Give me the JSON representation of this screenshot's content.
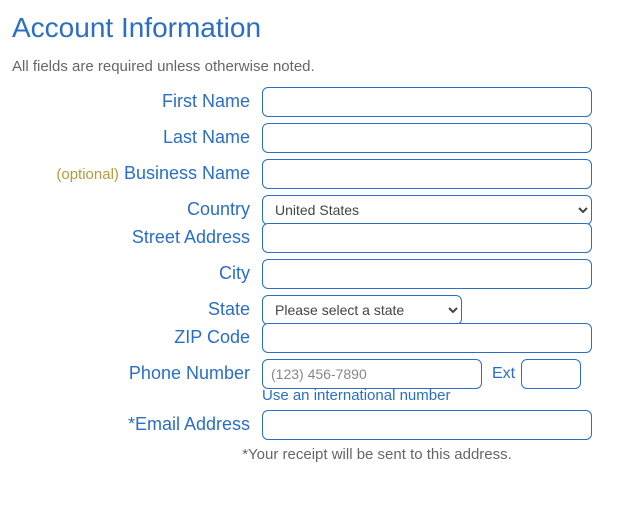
{
  "heading": "Account Information",
  "required_note": "All fields are required unless otherwise noted.",
  "labels": {
    "first_name": "First Name",
    "last_name": "Last Name",
    "optional": "(optional)",
    "business_name": "Business Name",
    "country": "Country",
    "street_address": "Street Address",
    "city": "City",
    "state": "State",
    "zip": "ZIP Code",
    "phone": "Phone Number",
    "ext": "Ext",
    "email": "*Email Address"
  },
  "values": {
    "first_name": "",
    "last_name": "",
    "business_name": "",
    "country_selected": "United States",
    "street_address": "",
    "city": "",
    "state_selected": "Please select a state",
    "zip": "",
    "phone": "",
    "ext": "",
    "email": ""
  },
  "placeholders": {
    "phone": "(123) 456-7890"
  },
  "intl_link": "Use an international number",
  "receipt_note": "*Your receipt will be sent to this address."
}
